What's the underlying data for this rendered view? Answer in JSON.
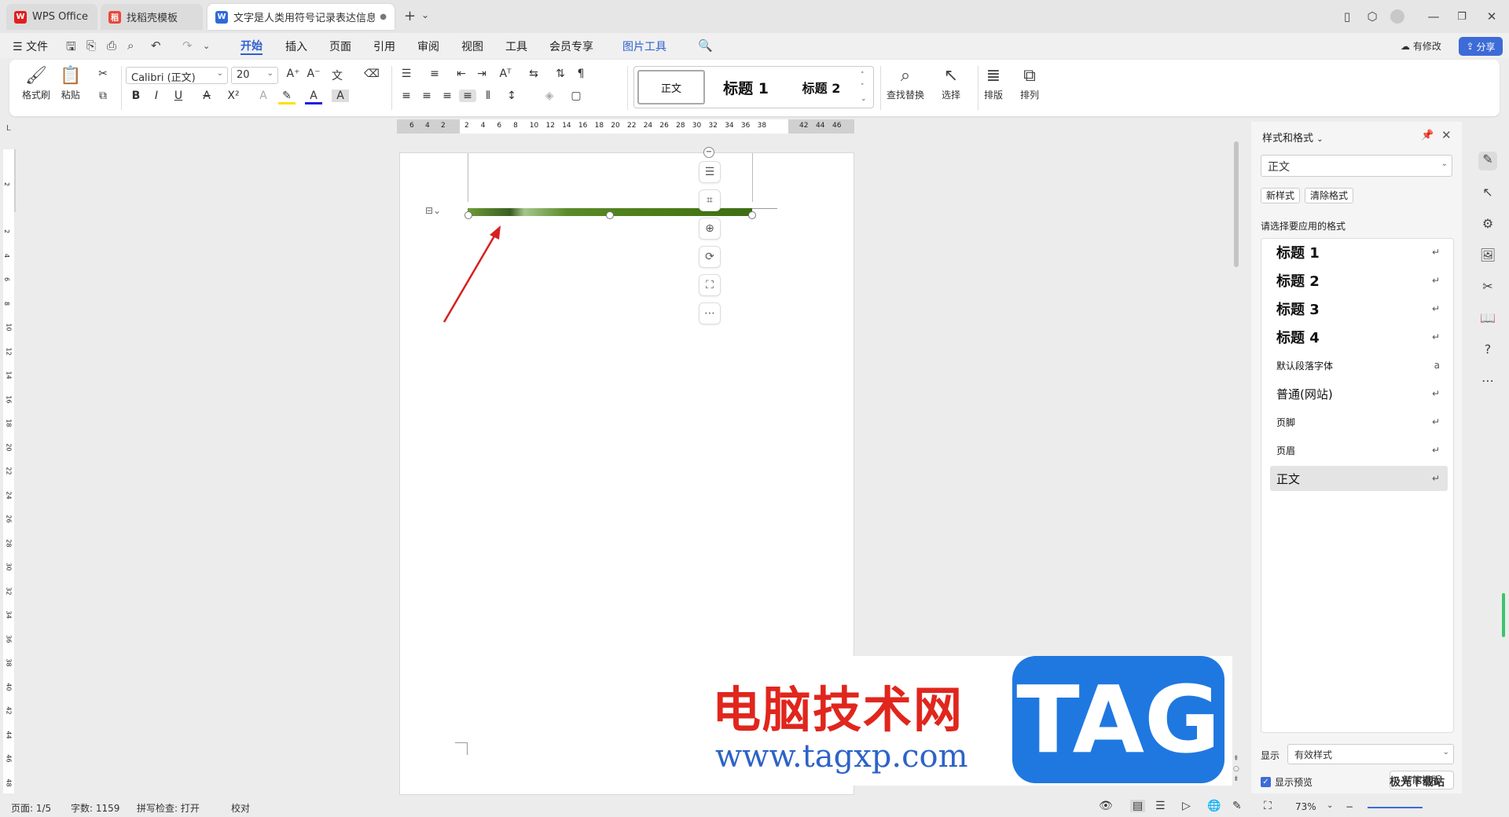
{
  "tabs": [
    {
      "label": "WPS Office",
      "icon": "wps-logo-icon"
    },
    {
      "label": "找稻壳模板",
      "icon": "docer-icon"
    },
    {
      "label": "文字是人类用符号记录表达信息以",
      "icon": "writer-doc-icon"
    }
  ],
  "window": {
    "new_tab": "+",
    "tab_menu": "⌄"
  },
  "menu": {
    "file": "☰ 文件",
    "items": [
      "开始",
      "插入",
      "页面",
      "引用",
      "审阅",
      "视图",
      "工具",
      "会员专享"
    ],
    "active": "开始",
    "context_tab": "图片工具",
    "has_changes": "有修改",
    "share": "分享"
  },
  "ribbon": {
    "format_painter": "格式刷",
    "paste": "粘贴",
    "font_name": "Calibri (正文)",
    "font_size": "20",
    "styles": [
      "正文",
      "标题 1",
      "标题 2"
    ],
    "find_replace": "查找替换",
    "select": "选择",
    "layout": "排版",
    "arrange": "排列"
  },
  "ruler": {
    "h_ticks": [
      "6",
      "4",
      "2",
      "2",
      "4",
      "6",
      "8",
      "10",
      "12",
      "14",
      "16",
      "18",
      "20",
      "22",
      "24",
      "26",
      "28",
      "30",
      "32",
      "34",
      "36",
      "38",
      "42",
      "44",
      "46"
    ],
    "v_ticks": [
      "2",
      "2",
      "4",
      "6",
      "8",
      "10",
      "12",
      "14",
      "16",
      "18",
      "20",
      "22",
      "24",
      "26",
      "28",
      "30",
      "32",
      "34",
      "36",
      "38",
      "40",
      "42",
      "44",
      "46",
      "48"
    ]
  },
  "panel": {
    "title": "样式和格式",
    "current": "正文",
    "new_style": "新样式",
    "clear_format": "清除格式",
    "hint": "请选择要应用的格式",
    "styles": [
      {
        "label": "标题 1",
        "kind": "h"
      },
      {
        "label": "标题 2",
        "kind": "h"
      },
      {
        "label": "标题 3",
        "kind": "h"
      },
      {
        "label": "标题 4",
        "kind": "h"
      },
      {
        "label": "默认段落字体",
        "kind": "s"
      },
      {
        "label": "普通(网站)",
        "kind": "m"
      },
      {
        "label": "页脚",
        "kind": "s"
      },
      {
        "label": "页眉",
        "kind": "s"
      },
      {
        "label": "正文",
        "kind": "m"
      }
    ],
    "show_label": "显示",
    "show_value": "有效样式",
    "preview_label": "显示预览",
    "smart_layout": "智能排版"
  },
  "status": {
    "page": "页面: 1/5",
    "words": "字数: 1159",
    "spell": "拼写检查: 打开",
    "proof": "校对",
    "zoom": "73%"
  },
  "watermark": {
    "title": "电脑技术网",
    "url": "www.tagxp.com",
    "logo": "TAG",
    "corner": "极光下载站"
  },
  "colors": {
    "accent": "#3d6bd8",
    "arrow": "#d62020",
    "image_green": "#4f7f1a"
  }
}
